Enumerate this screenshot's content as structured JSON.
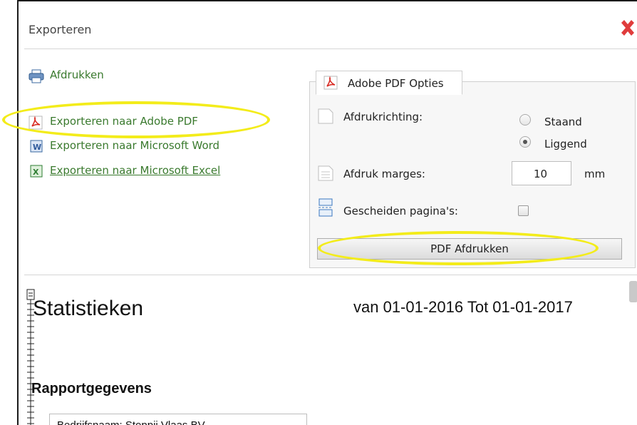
{
  "dialog": {
    "title": "Exporteren",
    "close_icon": "close-icon"
  },
  "export_links": [
    {
      "label": "Afdrukken",
      "icon": "printer-icon"
    },
    {
      "label": "Exporteren naar Adobe PDF",
      "icon": "pdf-icon"
    },
    {
      "label": "Exporteren naar Microsoft Word",
      "icon": "word-icon"
    },
    {
      "label": "Exporteren naar Microsoft Excel",
      "icon": "excel-icon"
    }
  ],
  "pdf_options": {
    "tab_label": "Adobe PDF Opties",
    "orientation_label": "Afdrukrichting:",
    "orientation_options": [
      "Staand",
      "Liggend"
    ],
    "orientation_selected": "Liggend",
    "margins_label": "Afdruk marges:",
    "margins_value": "10",
    "margins_unit": "mm",
    "separate_pages_label": "Gescheiden pagina's:",
    "separate_pages_checked": false,
    "print_button": "PDF Afdrukken"
  },
  "report": {
    "title": "Statistieken",
    "date_range": "van 01-01-2016 Tot 01-01-2017",
    "section": "Rapportgegevens",
    "company_line": "Bedrijfsnaam: Stoppij Vlaas BV"
  },
  "colors": {
    "link": "#3a7a2e",
    "highlight": "#f3ec1a",
    "close": "#e03c3c"
  }
}
